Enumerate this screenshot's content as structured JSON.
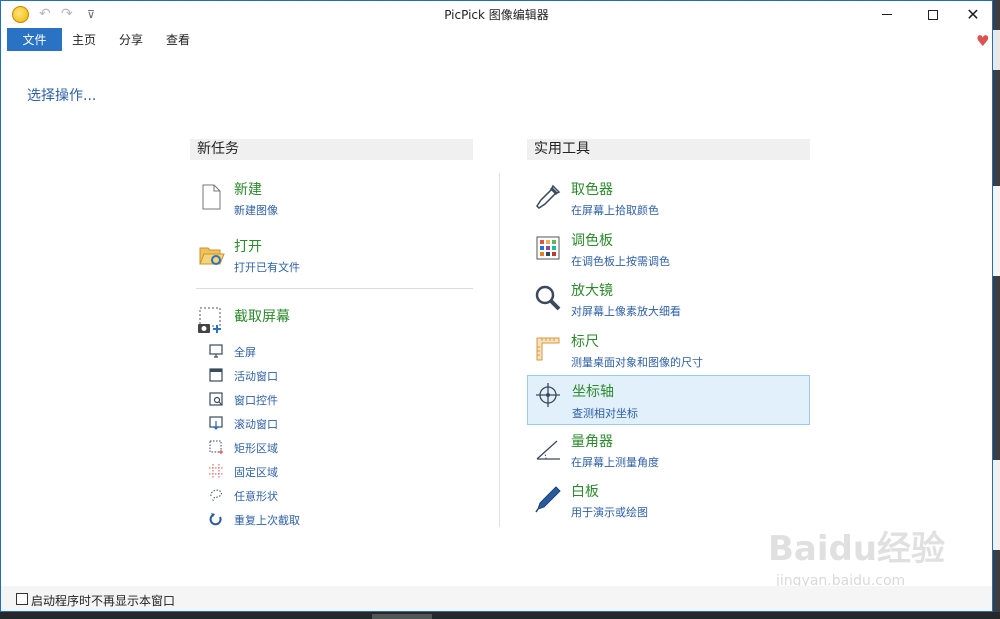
{
  "window": {
    "title": "PicPick 图像编辑器"
  },
  "titlebar": {
    "undo_glyph": "↶",
    "redo_glyph": "↷",
    "more_glyph": "⊽",
    "close_glyph": "✕"
  },
  "tabs": [
    {
      "label": "文件",
      "active": true
    },
    {
      "label": "主页"
    },
    {
      "label": "分享"
    },
    {
      "label": "查看"
    }
  ],
  "heart_glyph": "♥",
  "page": {
    "choose_label": "选择操作..."
  },
  "new_task": {
    "header": "新任务",
    "items": [
      {
        "icon": "new-file-icon",
        "title": "新建",
        "subtitle": "新建图像"
      },
      {
        "icon": "open-folder-icon",
        "title": "打开",
        "subtitle": "打开已有文件"
      },
      {
        "icon": "screen-capture-icon",
        "title": "截取屏幕",
        "subtitle": ""
      }
    ],
    "capture_options": [
      {
        "icon": "monitor-icon",
        "label": "全屏"
      },
      {
        "icon": "window-icon",
        "label": "活动窗口"
      },
      {
        "icon": "window-control-icon",
        "label": "窗口控件"
      },
      {
        "icon": "scroll-window-icon",
        "label": "滚动窗口"
      },
      {
        "icon": "rect-region-icon",
        "label": "矩形区域"
      },
      {
        "icon": "fixed-region-icon",
        "label": "固定区域"
      },
      {
        "icon": "freehand-icon",
        "label": "任意形状"
      },
      {
        "icon": "repeat-icon",
        "label": "重复上次截取"
      }
    ]
  },
  "tools": {
    "header": "实用工具",
    "items": [
      {
        "icon": "eyedropper-icon",
        "title": "取色器",
        "subtitle": "在屏幕上拾取颜色"
      },
      {
        "icon": "palette-icon",
        "title": "调色板",
        "subtitle": "在调色板上按需调色"
      },
      {
        "icon": "magnifier-icon",
        "title": "放大镜",
        "subtitle": "对屏幕上像素放大细看"
      },
      {
        "icon": "ruler-icon",
        "title": "标尺",
        "subtitle": "测量桌面对象和图像的尺寸"
      },
      {
        "icon": "crosshair-icon",
        "title": "坐标轴",
        "subtitle": "查测相对坐标",
        "selected": true
      },
      {
        "icon": "protractor-icon",
        "title": "量角器",
        "subtitle": "在屏幕上测量角度"
      },
      {
        "icon": "pen-icon",
        "title": "白板",
        "subtitle": "用于演示或绘图"
      }
    ]
  },
  "footer": {
    "checkbox_label": "启动程序时不再显示本窗口",
    "checked": false
  },
  "watermark": {
    "logo": "Baidu经验",
    "url": "jingyan.baidu.com"
  },
  "colors": {
    "accent": "#2a72c4",
    "title_green": "#2c8a2c",
    "link_blue": "#2d5fa5",
    "selected_bg": "#e2f0fb"
  }
}
